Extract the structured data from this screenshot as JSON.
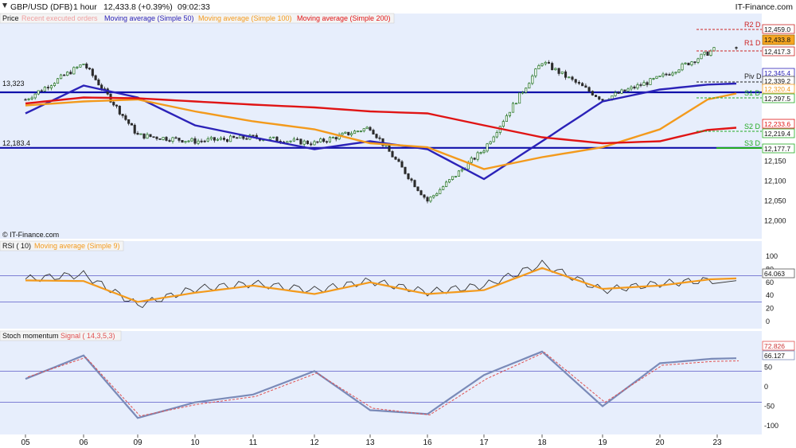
{
  "header": {
    "symbol": "GBP/USD (DFB)",
    "timeframe": "1 hour",
    "price_change": "12,433.8 (+0.39%)",
    "time": "09:02:33",
    "brand": "IT-Finance.com"
  },
  "colors": {
    "panel_bg": "#e7eefc",
    "legend_bg": "#f4f4f4",
    "grid": "#aab4d0",
    "candle_up": "#1c6e1c",
    "candle_down": "#2a2a2a",
    "ma50": "#2b22b8",
    "ma100": "#f39a1c",
    "ma200": "#e01414",
    "sr_line": "#1111aa",
    "rsi_line": "#333333",
    "rsi_ma": "#f39a1c",
    "stoch_k": "#7a8ab8",
    "stoch_d": "#e05050",
    "current_price_bg": "#f5a623",
    "label_box": "#ffffff"
  },
  "price_panel": {
    "legend": [
      "Price",
      "Recent executed orders",
      "Moving average (Simple 50)",
      "Moving average (Simple 100)",
      "Moving average (Simple 200)"
    ],
    "watermark": "© IT-Finance.com",
    "left_labels": [
      "13,323",
      "12,183.4"
    ],
    "levels": [
      {
        "name": "R2 D",
        "value": "12,459.0",
        "color": "#cc2222"
      },
      {
        "name": "R1 D",
        "value": "12,417.3",
        "color": "#cc2222"
      },
      {
        "name": "Piv D",
        "value": "12,339.2",
        "color": "#222222"
      },
      {
        "name": "S1 D",
        "value": "12,297.5",
        "color": "#22aa22"
      },
      {
        "name": "S2 D",
        "value": "12,219.4",
        "color": "#22aa22"
      },
      {
        "name": "S3 D",
        "value": "12,177.7",
        "color": "#22aa22"
      }
    ],
    "ma_values": {
      "ma50": "12,345.4",
      "ma100": "12,320.4",
      "ma200": "12,233.6"
    },
    "current_price": "12,433.8"
  },
  "rsi_panel": {
    "legend": [
      "RSI ( 10)",
      "Moving average (Simple 9)"
    ],
    "current": "64.063"
  },
  "stoch_panel": {
    "legend": [
      "Stoch momentum",
      "Signal ( 14,3,5,3)"
    ],
    "values": [
      "72.826",
      "66.127"
    ]
  },
  "x_axis": {
    "dates": [
      "05",
      "06",
      "09",
      "10",
      "11",
      "12",
      "13",
      "16",
      "17",
      "18",
      "19",
      "20",
      "23"
    ]
  },
  "chart_data": [
    {
      "type": "line",
      "title": "GBP/USD (DFB)",
      "subtitle": "1 hour",
      "x": [
        "05",
        "06",
        "09",
        "10",
        "11",
        "12",
        "13",
        "16",
        "17",
        "18",
        "19",
        "20",
        "23"
      ],
      "yticks": [
        12000,
        12050,
        12100,
        12150,
        12200,
        12250,
        12300,
        12350,
        12400,
        12450
      ],
      "ytick_labels": [
        "12,000",
        "12,050",
        "12,100",
        "12,150"
      ],
      "ylim": [
        11985,
        12475
      ],
      "series": [
        {
          "name": "Price",
          "values": [
            12305,
            12395,
            12215,
            12200,
            12210,
            12195,
            12235,
            12050,
            12180,
            12400,
            12305,
            12360,
            12434
          ]
        },
        {
          "name": "Moving average (Simple 50)",
          "values": [
            12270,
            12340,
            12310,
            12240,
            12210,
            12180,
            12200,
            12180,
            12105,
            12200,
            12300,
            12330,
            12345
          ]
        },
        {
          "name": "Moving average (Simple 100)",
          "values": [
            12290,
            12300,
            12305,
            12275,
            12250,
            12230,
            12195,
            12185,
            12130,
            12160,
            12185,
            12230,
            12320
          ]
        },
        {
          "name": "Moving average (Simple 200)",
          "values": [
            12295,
            12310,
            12308,
            12300,
            12292,
            12285,
            12275,
            12270,
            12240,
            12210,
            12195,
            12200,
            12234
          ]
        }
      ],
      "horizontal_lines": [
        12323,
        12183.4
      ],
      "grid": false,
      "legend": "top-left"
    },
    {
      "type": "line",
      "title": "RSI ( 10)",
      "x": [
        "05",
        "06",
        "09",
        "10",
        "11",
        "12",
        "13",
        "16",
        "17",
        "18",
        "19",
        "20",
        "23"
      ],
      "yticks": [
        0,
        20,
        40,
        60,
        80,
        100
      ],
      "ylim": [
        -5,
        105
      ],
      "reference_lines": [
        30,
        70
      ],
      "series": [
        {
          "name": "RSI ( 10)",
          "values": [
            65,
            72,
            25,
            50,
            58,
            48,
            62,
            45,
            55,
            88,
            48,
            58,
            64.063
          ]
        },
        {
          "name": "Moving average (Simple 9)",
          "values": [
            63,
            62,
            30,
            44,
            55,
            42,
            60,
            42,
            48,
            82,
            50,
            55,
            66
          ]
        }
      ],
      "grid": false
    },
    {
      "type": "line",
      "title": "Stoch momentum",
      "x": [
        "05",
        "06",
        "09",
        "10",
        "11",
        "12",
        "13",
        "16",
        "17",
        "18",
        "19",
        "20",
        "23"
      ],
      "yticks": [
        -100,
        -50,
        0,
        50,
        100
      ],
      "ylim": [
        -110,
        110
      ],
      "reference_lines": [
        -40,
        40
      ],
      "series": [
        {
          "name": "Stoch momentum",
          "values": [
            20,
            80,
            -80,
            -40,
            -20,
            40,
            -60,
            -70,
            30,
            90,
            -50,
            60,
            72.826
          ]
        },
        {
          "name": "Signal ( 14,3,5,3)",
          "values": [
            25,
            75,
            -75,
            -45,
            -25,
            35,
            -55,
            -72,
            20,
            88,
            -40,
            55,
            66.127
          ]
        }
      ],
      "grid": false
    }
  ]
}
